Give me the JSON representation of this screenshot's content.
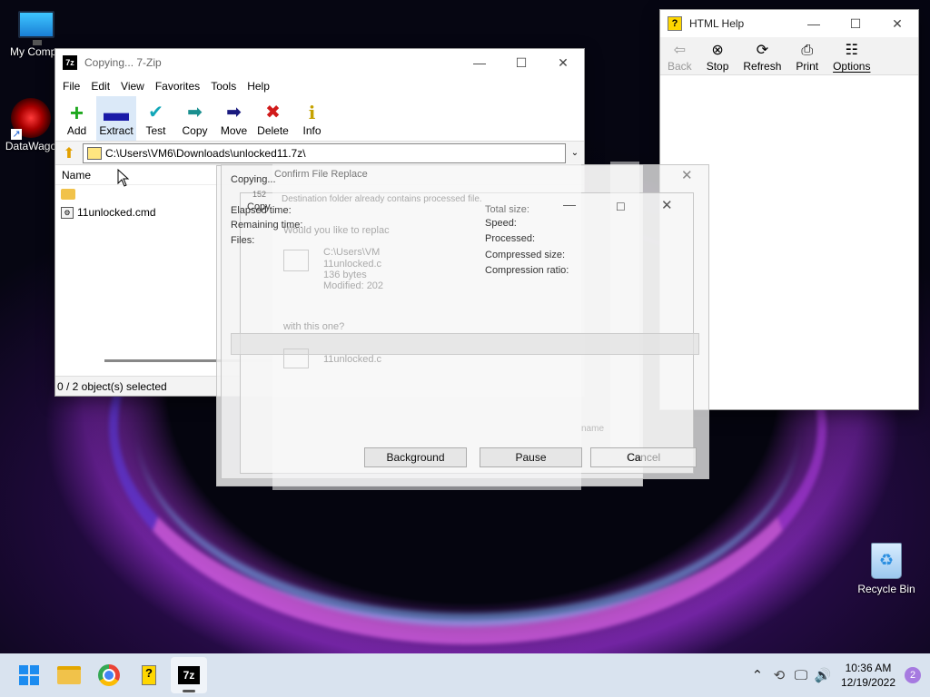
{
  "desktop": {
    "icons": [
      {
        "label": "My Compu"
      },
      {
        "label": "DataWago"
      }
    ],
    "recycle_bin": "Recycle Bin"
  },
  "zip_window": {
    "title": "Copying... 7-Zip",
    "menu": [
      "File",
      "Edit",
      "View",
      "Favorites",
      "Tools",
      "Help"
    ],
    "toolbar": [
      {
        "label": "Add",
        "icon": "plus-icon",
        "color": "#1ea81e"
      },
      {
        "label": "Extract",
        "icon": "minus-icon",
        "color": "#1a1aa8"
      },
      {
        "label": "Test",
        "icon": "check-icon",
        "color": "#12a7b8"
      },
      {
        "label": "Copy",
        "icon": "copy-arrow-icon",
        "color": "#1a8f8f"
      },
      {
        "label": "Move",
        "icon": "move-arrow-icon",
        "color": "#1a1a7f"
      },
      {
        "label": "Delete",
        "icon": "x-icon",
        "color": "#d11a1a"
      },
      {
        "label": "Info",
        "icon": "info-icon",
        "color": "#c6a200"
      }
    ],
    "address": "C:\\Users\\VM6\\Downloads\\unlocked11.7z\\",
    "column_name": "Name",
    "files": [
      {
        "name": "",
        "type": "folder"
      },
      {
        "name": "11unlocked.cmd",
        "type": "file"
      }
    ],
    "status": "0 / 2 object(s) selected"
  },
  "help_window": {
    "title": "HTML Help",
    "toolbar": [
      {
        "label": "Back",
        "disabled": true
      },
      {
        "label": "Stop",
        "disabled": false
      },
      {
        "label": "Refresh",
        "disabled": false
      },
      {
        "label": "Print",
        "disabled": false
      },
      {
        "label": "Options",
        "disabled": false
      }
    ]
  },
  "copy_dialogs": {
    "copying_title": "Copying...",
    "copying_count": "152",
    "copy_title": "Copy",
    "confirm_title": "Confirm File Replace",
    "confirm_sub": "Destination folder already contains processed file.",
    "elapsed": "Elapsed time:",
    "remaining": "Remaining time:",
    "files": "Files:",
    "total_size": "Total size:",
    "speed": "Speed:",
    "processed": "Processed:",
    "compressed_size": "Compressed size:",
    "compression_ratio": "Compression ratio:",
    "replace_question": "Would you like to replac",
    "existing_path": "C:\\Users\\VM",
    "existing_name": "11unlocked.c",
    "existing_size": "136 bytes",
    "existing_modified": "Modified: 202",
    "with_this": "with this one?",
    "new_name": "11unlocked.c",
    "background_btn": "Background",
    "pause_btn": "Pause",
    "cancel_btn": "Cancel",
    "cancel_partial": "Ca",
    "name_lbl": "name"
  },
  "taskbar": {
    "time": "10:36 AM",
    "date": "12/19/2022",
    "notifications": "2"
  }
}
